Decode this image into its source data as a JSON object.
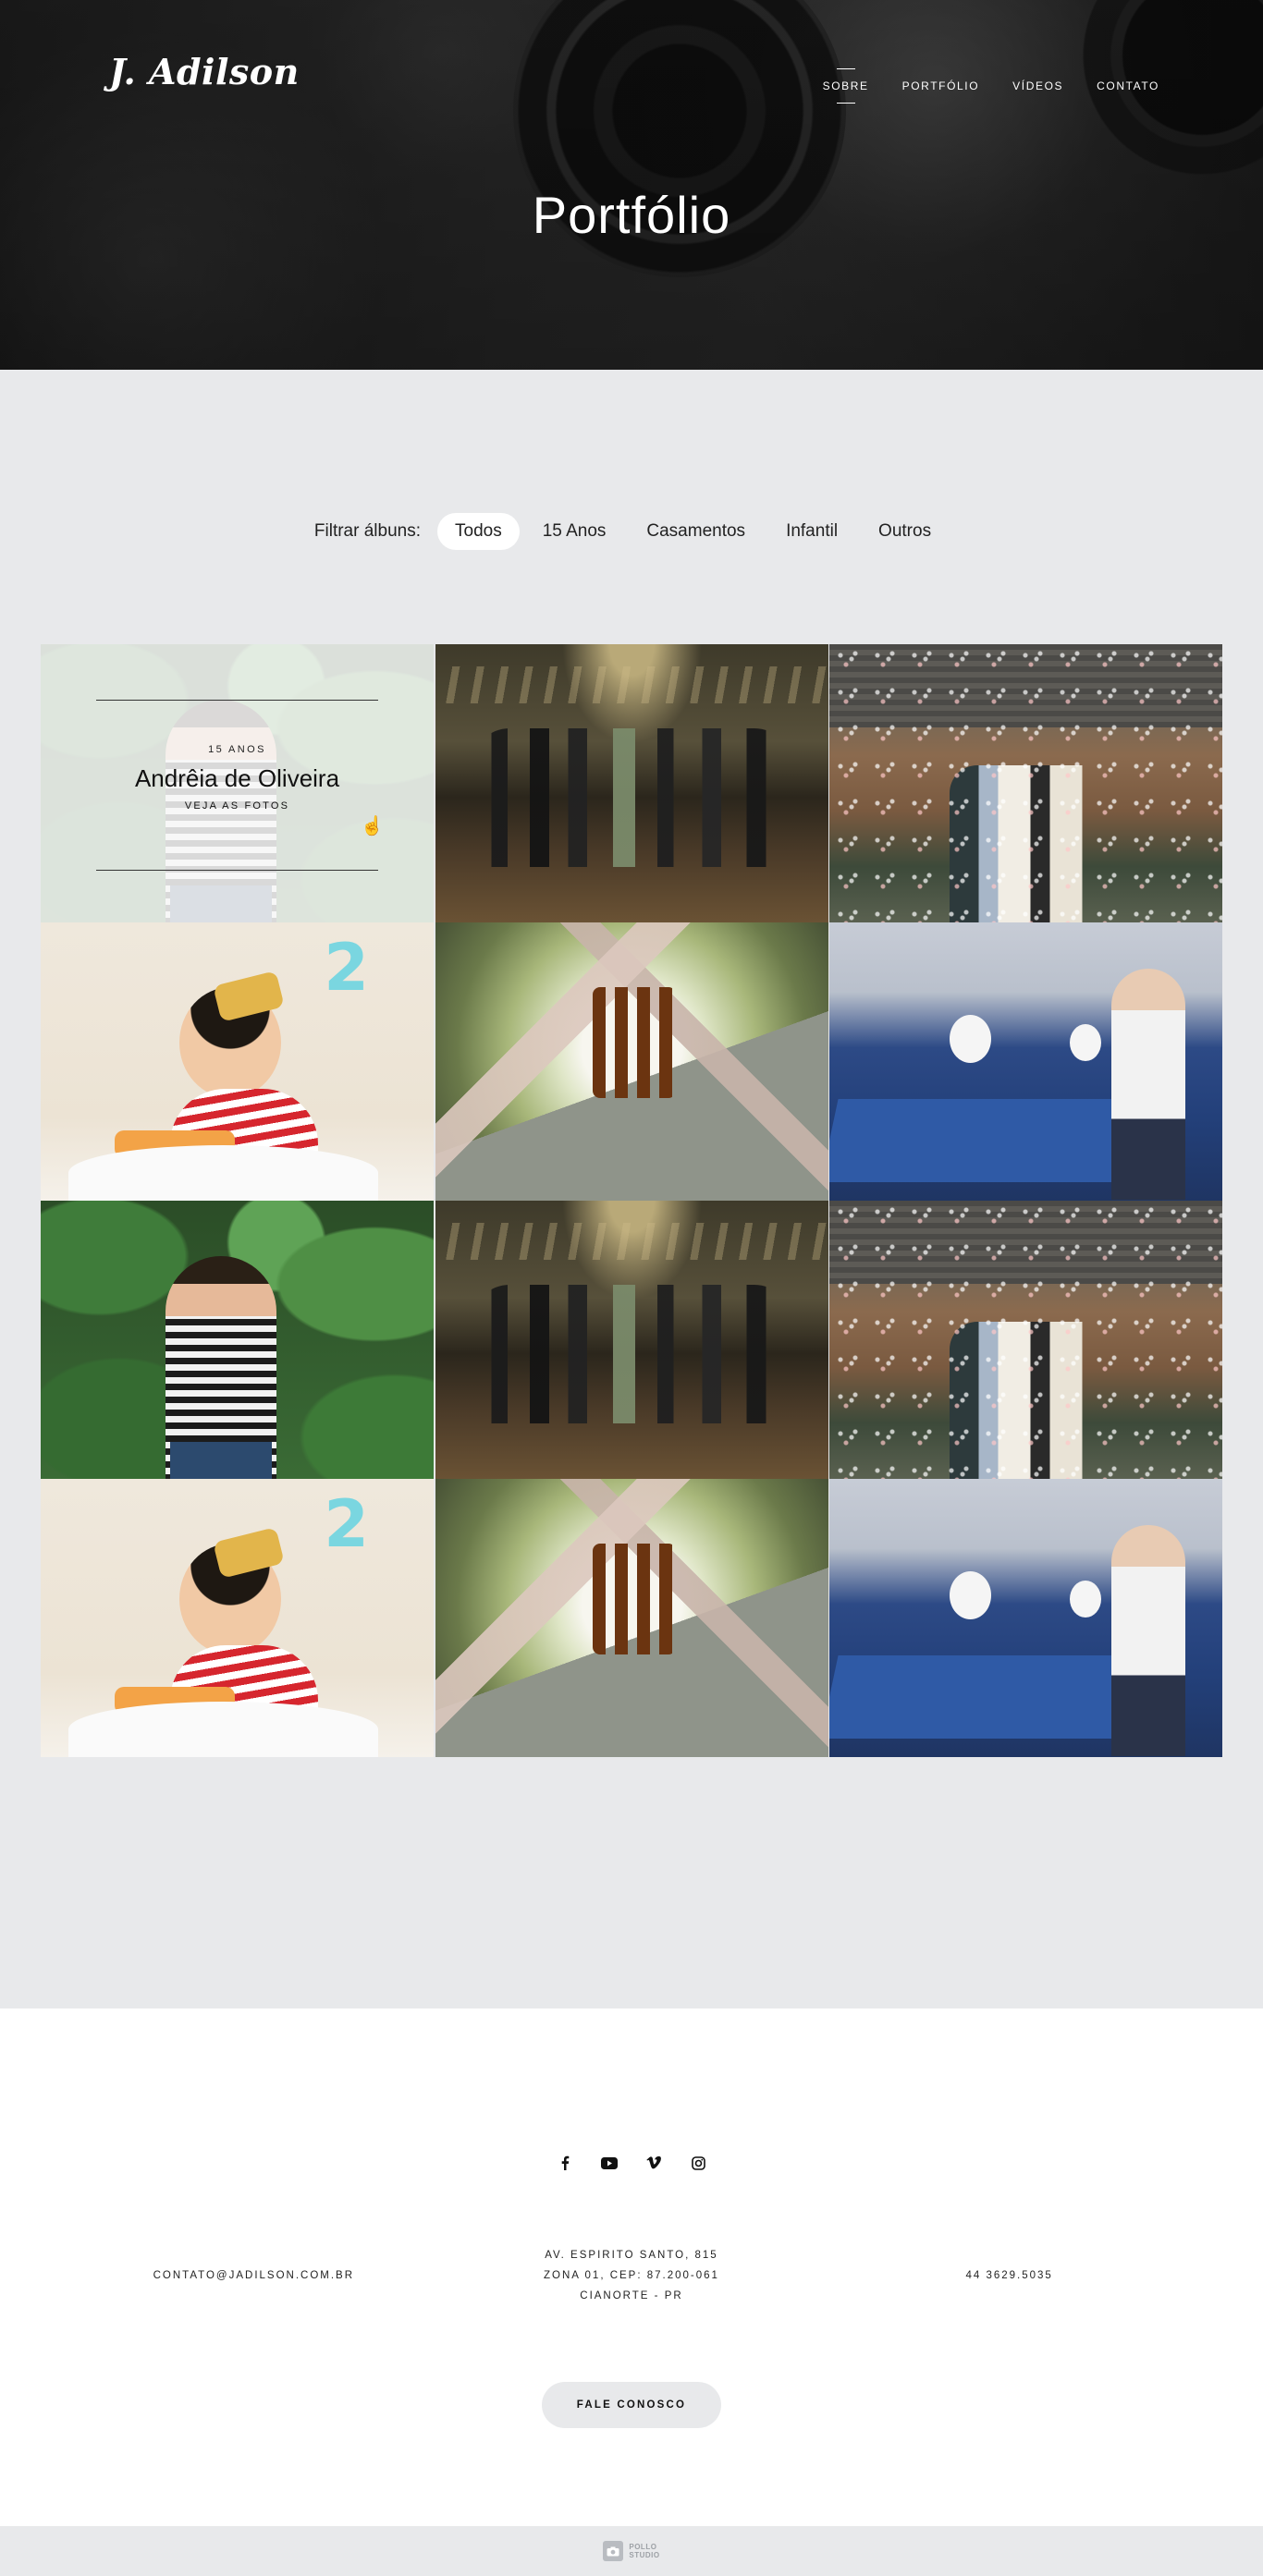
{
  "header": {
    "logo": "J. Adilson",
    "nav": [
      "SOBRE",
      "PORTFÓLIO",
      "VÍDEOS",
      "CONTATO"
    ],
    "active_nav": "SOBRE",
    "title": "Portfólio"
  },
  "filter": {
    "label": "Filtrar álbuns:",
    "options": [
      "Todos",
      "15 Anos",
      "Casamentos",
      "Infantil",
      "Outros"
    ],
    "active": "Todos"
  },
  "featured_album": {
    "category": "15 ANOS",
    "name": "Andrêia de Oliveira",
    "link": "VEJA AS FOTOS"
  },
  "footer": {
    "social": [
      "facebook-icon",
      "youtube-icon",
      "vimeo-icon",
      "instagram-icon"
    ],
    "email": "CONTATO@JADILSON.COM.BR",
    "address_line1": "AV. ESPIRITO SANTO, 815",
    "address_line2": "ZONA 01, CEP: 87.200-061",
    "address_line3": "CIANORTE - PR",
    "phone": "44 3629.5035",
    "cta": "FALE CONOSCO",
    "credit_line1": "POLLO",
    "credit_line2": "STUDIO"
  },
  "colors": {
    "page_bg": "#e8e9eb",
    "footer_bg": "#ffffff",
    "text": "#222222"
  }
}
